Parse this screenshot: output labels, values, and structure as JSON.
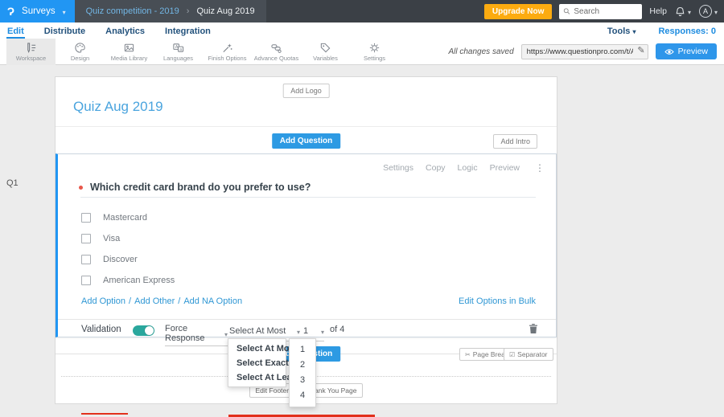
{
  "topbar": {
    "logo_glyph": "Ɂ",
    "product": "Surveys",
    "breadcrumb": {
      "parent": "Quiz competition - 2019",
      "separator": "›",
      "current": "Quiz Aug 2019"
    },
    "upgrade_label": "Upgrade Now",
    "search_placeholder": "Search",
    "help_label": "Help",
    "avatar_initial": "A"
  },
  "nav": {
    "tabs": [
      {
        "label": "Edit"
      },
      {
        "label": "Distribute"
      },
      {
        "label": "Analytics"
      },
      {
        "label": "Integration"
      }
    ],
    "tools_label": "Tools",
    "responses_label": "Responses: 0"
  },
  "toolbar": {
    "items": [
      {
        "label": "Workspace"
      },
      {
        "label": "Design"
      },
      {
        "label": "Media Library"
      },
      {
        "label": "Languages"
      },
      {
        "label": "Finish Options"
      },
      {
        "label": "Advance Quotas"
      },
      {
        "label": "Variables"
      },
      {
        "label": "Settings"
      }
    ],
    "saved_status": "All changes saved",
    "share_url": "https://www.questionpro.com/t/APNrFZ",
    "preview_label": "Preview"
  },
  "survey": {
    "question_number": "Q1",
    "add_logo_label": "Add Logo",
    "title": "Quiz Aug 2019",
    "add_question_label": "Add Question",
    "add_intro_label": "Add Intro"
  },
  "question": {
    "actions": {
      "settings": "Settings",
      "copy": "Copy",
      "logic": "Logic",
      "preview": "Preview"
    },
    "text": "Which credit card brand do you prefer to use?",
    "options": [
      {
        "label": "Mastercard"
      },
      {
        "label": "Visa"
      },
      {
        "label": "Discover"
      },
      {
        "label": "American Express"
      }
    ],
    "links": {
      "add_option": "Add Option",
      "add_other": "Add Other",
      "add_na": "Add NA Option",
      "slash": "/",
      "bulk_edit": "Edit Options in Bulk"
    },
    "validation": {
      "label": "Validation",
      "toggle_state": "on",
      "force_response": "Force Response",
      "rule_value": "Select At Most",
      "count_value": "1",
      "of_label": "of 4"
    }
  },
  "dropdowns": {
    "rule_options": [
      {
        "label": "Select At Most"
      },
      {
        "label": "Select Exactly"
      },
      {
        "label": "Select At Least"
      }
    ],
    "count_options": [
      {
        "label": "1"
      },
      {
        "label": "2"
      },
      {
        "label": "3"
      },
      {
        "label": "4"
      }
    ]
  },
  "page_elements": {
    "page_break": "Page Break",
    "separator": "Separator",
    "edit_footer": "Edit Footer",
    "thank_you": "Thank You Page"
  },
  "colors": {
    "brand_blue": "#2196f3",
    "topbar_bg": "#3b4046",
    "accent_orange": "#fcab10",
    "toggle_teal": "#2aa79d",
    "annotation_red": "#e2301c",
    "link_blue": "#2f97d4",
    "title_blue": "#4aa4de"
  }
}
